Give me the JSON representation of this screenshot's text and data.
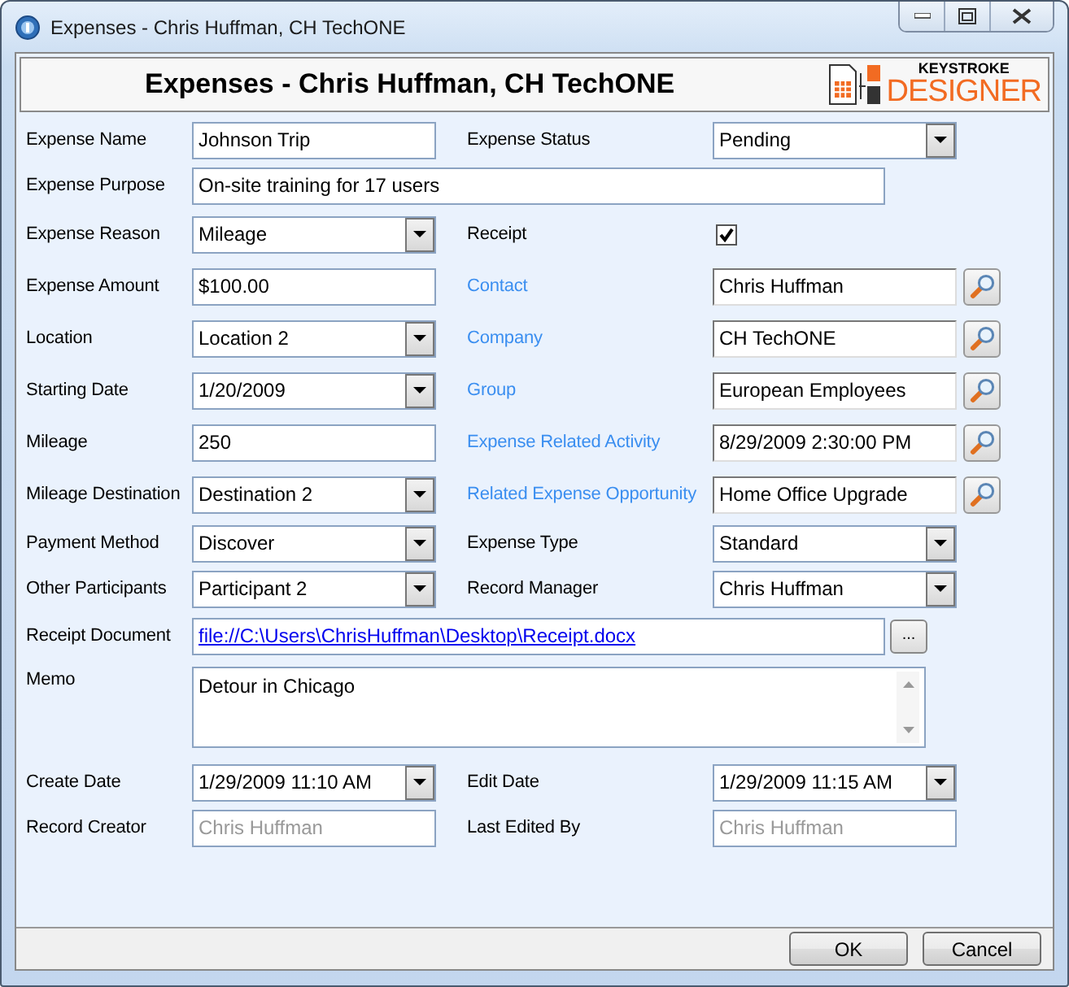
{
  "window": {
    "title": "Expenses - Chris Huffman, CH TechONE"
  },
  "header": {
    "title": "Expenses - Chris Huffman, CH TechONE",
    "logo": {
      "line_1": "KEYSTROKE",
      "line_2": "DESIGNER"
    }
  },
  "rows": [
    {
      "left": {
        "label": "Expense Name",
        "link": false,
        "kind": "text",
        "value": "Johnson Trip"
      },
      "right": {
        "label": "Expense Status",
        "link": false,
        "kind": "dropdown",
        "value": "Pending"
      }
    },
    {
      "left": {
        "label": "Expense Purpose",
        "link": false,
        "kind": "wide_text",
        "value": "On-site training for 17 users"
      }
    },
    {
      "left": {
        "label": "Expense Reason",
        "link": false,
        "kind": "dropdown",
        "value": "Mileage"
      },
      "right": {
        "label": "Receipt",
        "link": false,
        "kind": "checkbox",
        "checked": true
      }
    },
    {
      "left": {
        "label": "Expense Amount",
        "link": false,
        "kind": "text",
        "value": "$100.00"
      },
      "right": {
        "label": "Contact",
        "link": true,
        "kind": "lookup",
        "value": "Chris Huffman"
      }
    },
    {
      "left": {
        "label": "Location",
        "link": false,
        "kind": "dropdown",
        "value": "Location 2"
      },
      "right": {
        "label": "Company",
        "link": true,
        "kind": "lookup",
        "value": "CH TechONE"
      }
    },
    {
      "left": {
        "label": "Starting Date",
        "link": false,
        "kind": "dropdown",
        "value": "1/20/2009"
      },
      "right": {
        "label": "Group",
        "link": true,
        "kind": "lookup",
        "value": "European Employees"
      }
    },
    {
      "left": {
        "label": "Mileage",
        "link": false,
        "kind": "text",
        "value": "250"
      },
      "right": {
        "label": "Expense Related Activity",
        "link": true,
        "kind": "lookup",
        "value": "8/29/2009 2:30:00 PM"
      }
    },
    {
      "left": {
        "label": "Mileage Destination",
        "link": false,
        "kind": "dropdown",
        "value": "Destination 2"
      },
      "right": {
        "label": "Related Expense Opportunity",
        "link": true,
        "kind": "lookup",
        "value": "Home Office Upgrade"
      }
    },
    {
      "left": {
        "label": "Payment Method",
        "link": false,
        "kind": "dropdown",
        "value": "Discover"
      },
      "right": {
        "label": "Expense Type",
        "link": false,
        "kind": "dropdown",
        "value": "Standard"
      }
    },
    {
      "left": {
        "label": "Other Participants",
        "link": false,
        "kind": "dropdown",
        "value": "Participant 2"
      },
      "right": {
        "label": "Record Manager",
        "link": false,
        "kind": "dropdown",
        "value": "Chris Huffman"
      }
    },
    {
      "left": {
        "label": "Receipt Document",
        "link": false,
        "kind": "file",
        "value": "file://C:\\Users\\ChrisHuffman\\Desktop\\Receipt.docx",
        "button": "..."
      }
    },
    {
      "left": {
        "label": "Memo",
        "link": false,
        "kind": "memo",
        "value": "Detour in Chicago"
      }
    },
    {
      "left": {
        "label": "Create Date",
        "link": false,
        "kind": "dropdown",
        "value": "1/29/2009 11:10 AM"
      },
      "right": {
        "label": "Edit Date",
        "link": false,
        "kind": "dropdown",
        "value": "1/29/2009 11:15 AM"
      }
    },
    {
      "left": {
        "label": "Record Creator",
        "link": false,
        "kind": "readonly",
        "value": "Chris Huffman"
      },
      "right": {
        "label": "Last Edited By",
        "link": false,
        "kind": "readonly",
        "value": "Chris Huffman"
      }
    }
  ],
  "buttons": [
    {
      "label": "OK"
    },
    {
      "label": "Cancel"
    }
  ]
}
